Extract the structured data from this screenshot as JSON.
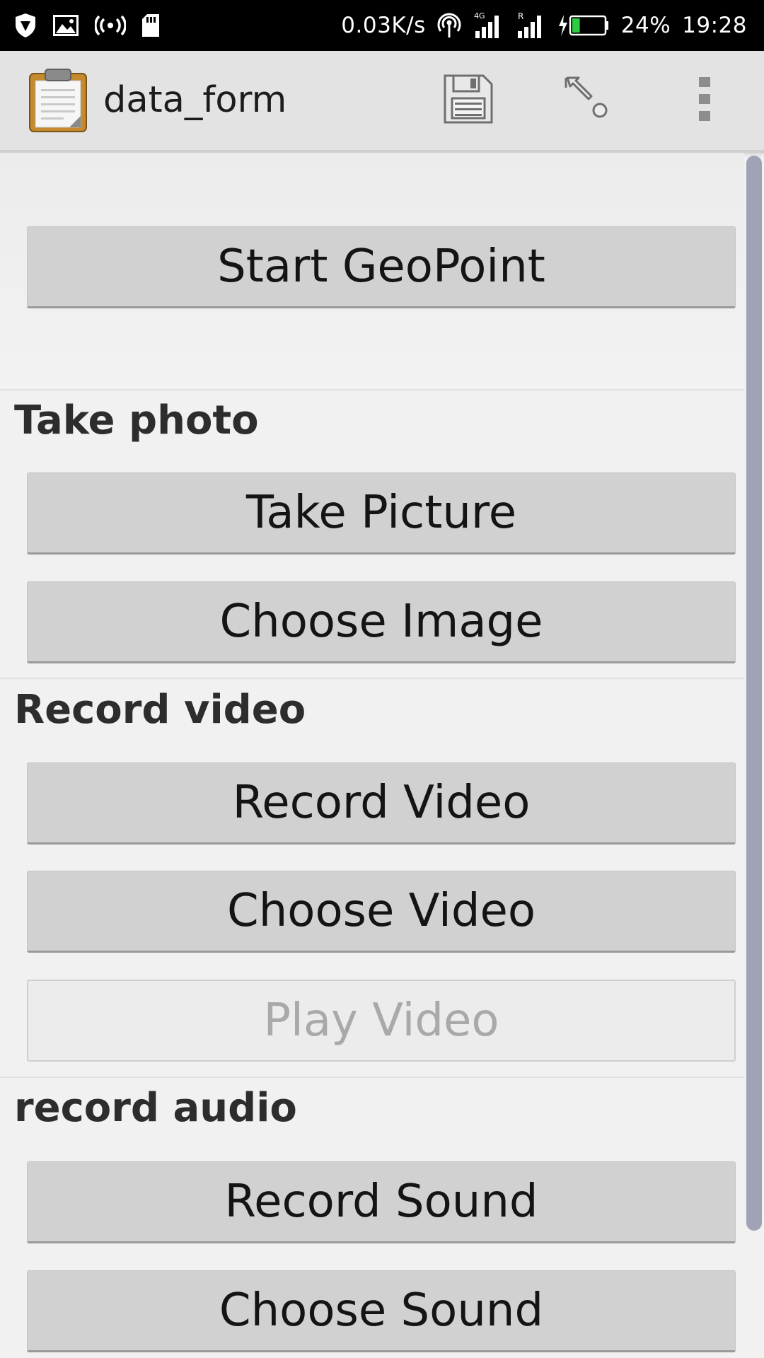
{
  "status_bar": {
    "network_speed": "0.03K/s",
    "network_type": "4G",
    "roaming_indicator": "R",
    "battery_percent": "24%",
    "time": "19:28",
    "battery_level": 0.24
  },
  "action_bar": {
    "title": "data_form",
    "icons": [
      "clipboard-icon",
      "save-icon",
      "go-to-prompt-icon",
      "overflow-menu-icon"
    ]
  },
  "form": {
    "geopoint_button": "Start GeoPoint",
    "sections": [
      {
        "label": "Take photo",
        "buttons": [
          "Take Picture",
          "Choose Image"
        ]
      },
      {
        "label": "Record video",
        "buttons": [
          "Record Video",
          "Choose Video",
          "Play Video"
        ],
        "disabled_button": "Play Video"
      },
      {
        "label": "record audio",
        "buttons": [
          "Record Sound",
          "Choose Sound"
        ]
      }
    ]
  },
  "colors": {
    "status_bar_bg": "#000000",
    "action_bar_bg": "#e3e3e3",
    "content_bg": "#f1f1f1",
    "button_bg": "#d1d1d1",
    "disabled_button_text": "#a9a9a9",
    "scrollbar": "#a0a3b6",
    "battery_fill": "#2ecc40"
  }
}
